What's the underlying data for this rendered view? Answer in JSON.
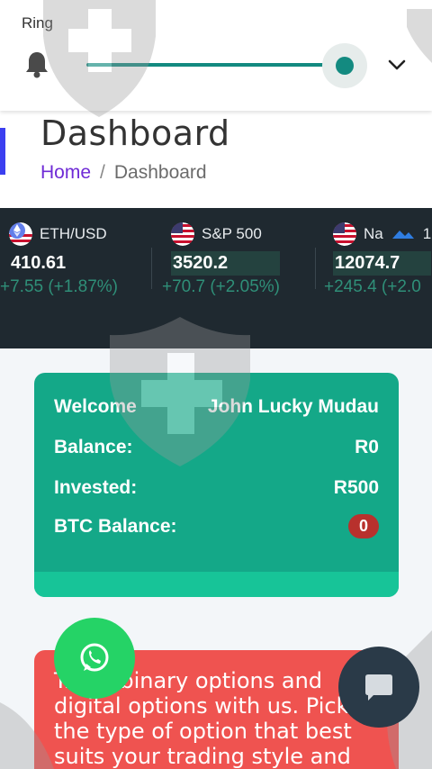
{
  "topbar": {
    "label": "Ring",
    "slider_value": 1.0
  },
  "header": {
    "title": "Dashboard",
    "breadcrumb": {
      "home": "Home",
      "separator": "/",
      "current": "Dashboard"
    }
  },
  "ticker": {
    "items": [
      {
        "symbol": "ETH/USD",
        "price": "410.61",
        "change": "+7.55 (+1.87%)"
      },
      {
        "symbol": "S&P 500",
        "price": "3520.2",
        "change": "+70.7 (+2.05%)"
      },
      {
        "symbol": "Na",
        "price": "12074.7",
        "change": "+245.4 (+2.0"
      }
    ],
    "extra": "1"
  },
  "welcome_card": {
    "welcome_label": "Welcome",
    "user_name": "John Lucky Mudau",
    "balance_label": "Balance:",
    "balance_value": "R0",
    "invested_label": "Invested:",
    "invested_value": "R500",
    "btc_label": "BTC Balance:",
    "btc_value": "0"
  },
  "info_card": {
    "text": "Trade binary options and digital options with us. Pick the type of option that best suits your trading style and"
  },
  "colors": {
    "accent_teal": "#138a80",
    "card_green": "#14a888",
    "card_red": "#ef5350",
    "ticker_bg": "#1f2930",
    "breadcrumb_home": "#6f2bd6",
    "whatsapp_green": "#25d366"
  },
  "icons": {
    "bell": "bell-icon",
    "chevron": "chevron-down-icon",
    "whatsapp": "whatsapp-icon",
    "chat": "chat-bubble-icon"
  }
}
